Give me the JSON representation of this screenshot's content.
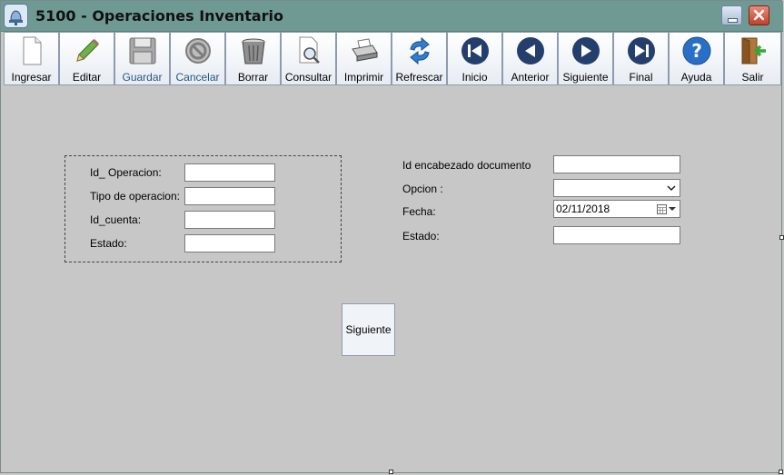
{
  "window": {
    "title": "5100 - Operaciones Inventario",
    "colors": {
      "titlebar": "#6f9a94",
      "background": "#c7c7c7",
      "close": "#c2402a"
    }
  },
  "toolbar": {
    "buttons": [
      {
        "label": "Ingresar",
        "icon": "new-document-icon",
        "enabled": true
      },
      {
        "label": "Editar",
        "icon": "pencil-icon",
        "enabled": true
      },
      {
        "label": "Guardar",
        "icon": "floppy-disk-icon",
        "enabled": false
      },
      {
        "label": "Cancelar",
        "icon": "cancel-icon",
        "enabled": false
      },
      {
        "label": "Borrar",
        "icon": "trash-can-icon",
        "enabled": true
      },
      {
        "label": "Consultar",
        "icon": "search-document-icon",
        "enabled": true
      },
      {
        "label": "Imprimir",
        "icon": "printer-icon",
        "enabled": true
      },
      {
        "label": "Refrescar",
        "icon": "refresh-icon",
        "enabled": true
      },
      {
        "label": "Inicio",
        "icon": "first-record-icon",
        "enabled": true
      },
      {
        "label": "Anterior",
        "icon": "previous-record-icon",
        "enabled": true
      },
      {
        "label": "Siguiente",
        "icon": "next-record-icon",
        "enabled": true
      },
      {
        "label": "Final",
        "icon": "last-record-icon",
        "enabled": true
      },
      {
        "label": "Ayuda",
        "icon": "help-icon",
        "enabled": true
      },
      {
        "label": "Salir",
        "icon": "exit-door-icon",
        "enabled": true
      }
    ]
  },
  "left_panel": {
    "id_operacion_label": "Id_ Operacion:",
    "tipo_operacion_label": "Tipo de operacion:",
    "id_cuenta_label": "Id_cuenta:",
    "estado_label": "Estado:",
    "id_operacion_value": "",
    "tipo_operacion_value": "",
    "id_cuenta_value": "",
    "estado_value": ""
  },
  "right_panel": {
    "id_encabezado_label": "Id encabezado documento",
    "opcion_label": "Opcion :",
    "fecha_label": "Fecha:",
    "estado_label": "Estado:",
    "id_encabezado_value": "",
    "opcion_value": "",
    "fecha_value": "02/11/2018",
    "estado_value": ""
  },
  "siguiente_button": {
    "label": "Siguiente"
  }
}
